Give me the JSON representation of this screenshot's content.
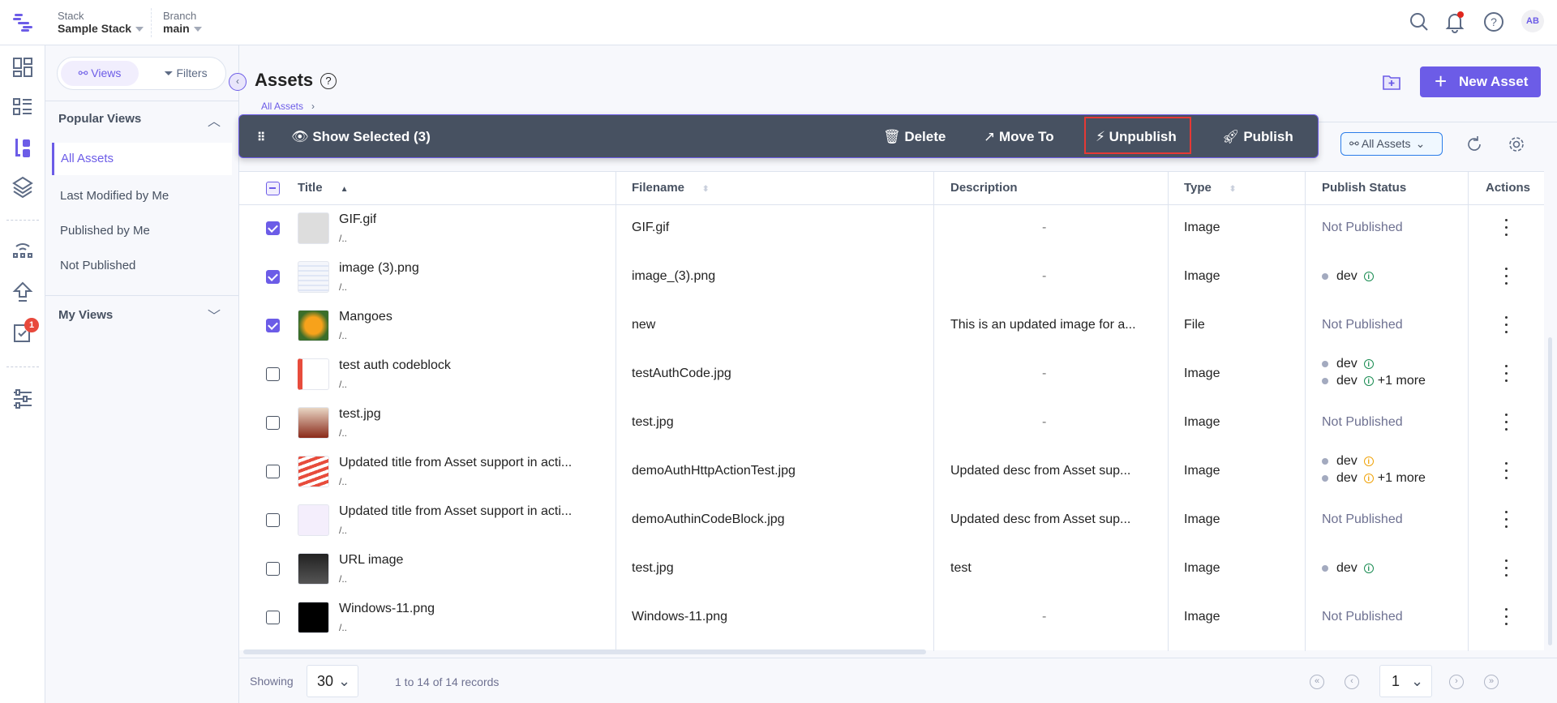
{
  "topbar": {
    "stack_label": "Stack",
    "stack_value": "Sample Stack",
    "branch_label": "Branch",
    "branch_value": "main",
    "avatar": "AB",
    "notification_dot_color": "#e0261d"
  },
  "rail": {
    "badge": "1"
  },
  "sidebar": {
    "tabs": [
      {
        "label": "Views",
        "active": true
      },
      {
        "label": "Filters",
        "active": false
      }
    ],
    "popular_views": "Popular Views",
    "items": [
      {
        "label": "All Assets",
        "active": true
      },
      {
        "label": "Last Modified by Me"
      },
      {
        "label": "Published by Me"
      },
      {
        "label": "Not Published"
      }
    ],
    "my_views": "My Views"
  },
  "header": {
    "title": "Assets",
    "breadcrumb": "All Assets",
    "new_asset": "New Asset",
    "accent": "#6c5ce7"
  },
  "bulk_toolbar": {
    "show_selected": "Show Selected (3)",
    "delete": "Delete",
    "move_to": "Move To",
    "unpublish": "Unpublish",
    "publish": "Publish",
    "highlight_color": "#e53935"
  },
  "view_select": "All Assets",
  "table": {
    "columns": [
      "Title",
      "Filename",
      "Description",
      "Type",
      "Publish Status",
      "Actions"
    ],
    "rows": [
      {
        "checked": true,
        "title": "GIF.gif",
        "path": "/..",
        "filename": "GIF.gif",
        "description": "-",
        "type": "Image",
        "status": [
          {
            "text": "Not Published"
          }
        ]
      },
      {
        "checked": true,
        "title": "image (3).png",
        "path": "/..",
        "filename": "image_(3).png",
        "description": "-",
        "type": "Image",
        "status": [
          {
            "env": "dev",
            "info": "ok"
          }
        ]
      },
      {
        "checked": true,
        "title": "Mangoes",
        "path": "/..",
        "filename": "new",
        "description": "This is an updated image for a...",
        "type": "File",
        "status": [
          {
            "text": "Not Published"
          }
        ]
      },
      {
        "checked": false,
        "title": "test auth codeblock",
        "path": "/..",
        "filename": "testAuthCode.jpg",
        "description": "-",
        "type": "Image",
        "status": [
          {
            "env": "dev",
            "info": "ok"
          },
          {
            "env": "dev",
            "info": "ok",
            "more": "+1 more"
          }
        ]
      },
      {
        "checked": false,
        "title": "test.jpg",
        "path": "/..",
        "filename": "test.jpg",
        "description": "-",
        "type": "Image",
        "status": [
          {
            "text": "Not Published"
          }
        ]
      },
      {
        "checked": false,
        "title": "Updated title from Asset support in acti...",
        "path": "/..",
        "filename": "demoAuthHttpActionTest.jpg",
        "description": "Updated desc from Asset sup...",
        "type": "Image",
        "status": [
          {
            "env": "dev",
            "info": "warn"
          },
          {
            "env": "dev",
            "info": "warn",
            "more": "+1 more"
          }
        ]
      },
      {
        "checked": false,
        "title": "Updated title from Asset support in acti...",
        "path": "/..",
        "filename": "demoAuthinCodeBlock.jpg",
        "description": "Updated desc from Asset sup...",
        "type": "Image",
        "status": [
          {
            "text": "Not Published"
          }
        ]
      },
      {
        "checked": false,
        "title": "URL image",
        "path": "/..",
        "filename": "test.jpg",
        "description": "test",
        "type": "Image",
        "status": [
          {
            "env": "dev",
            "info": "ok"
          }
        ]
      },
      {
        "checked": false,
        "title": "Windows-11.png",
        "path": "/..",
        "filename": "Windows-11.png",
        "description": "-",
        "type": "Image",
        "status": [
          {
            "text": "Not Published"
          }
        ]
      }
    ]
  },
  "footer": {
    "showing": "Showing",
    "per_page": "30",
    "records": "1 to 14 of 14 records",
    "page": "1"
  }
}
